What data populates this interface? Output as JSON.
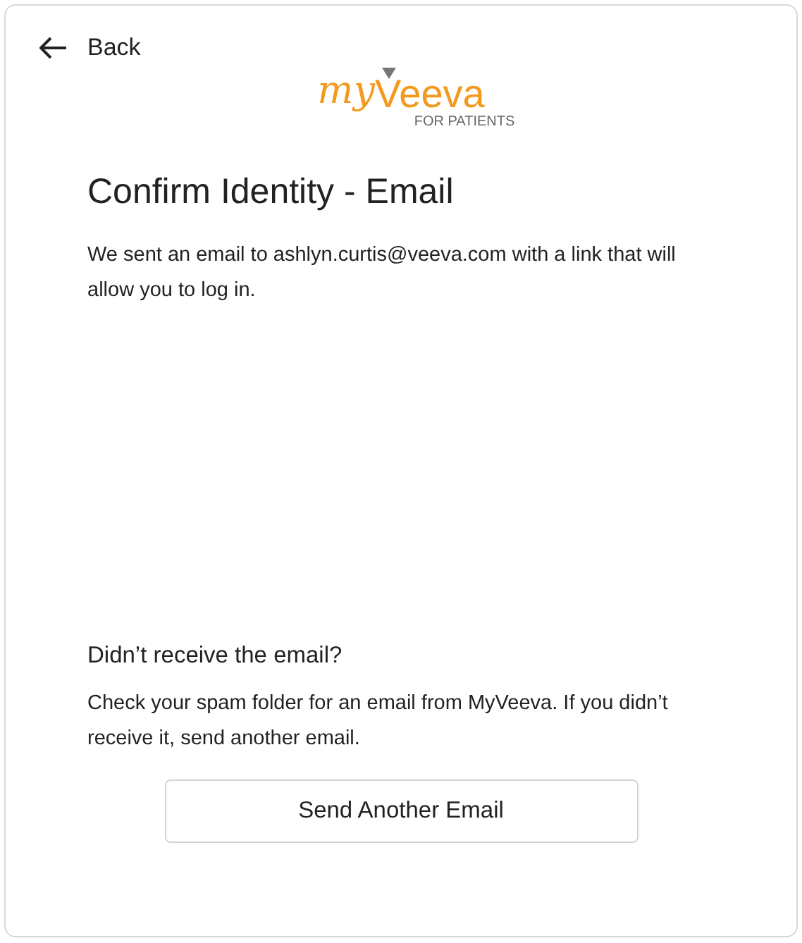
{
  "back": {
    "label": "Back"
  },
  "logo": {
    "prefix": "my",
    "name": "Veeva",
    "tagline": "FOR PATIENTS"
  },
  "title": "Confirm Identity - Email",
  "message": "We sent an email to ashlyn.curtis@veeva.com with a link that will allow you to log in.",
  "help": {
    "heading": "Didn’t receive the email?",
    "text": "Check your spam folder for an email from MyVeeva. If you didn’t receive it, send another email."
  },
  "button": "Send Another Email"
}
